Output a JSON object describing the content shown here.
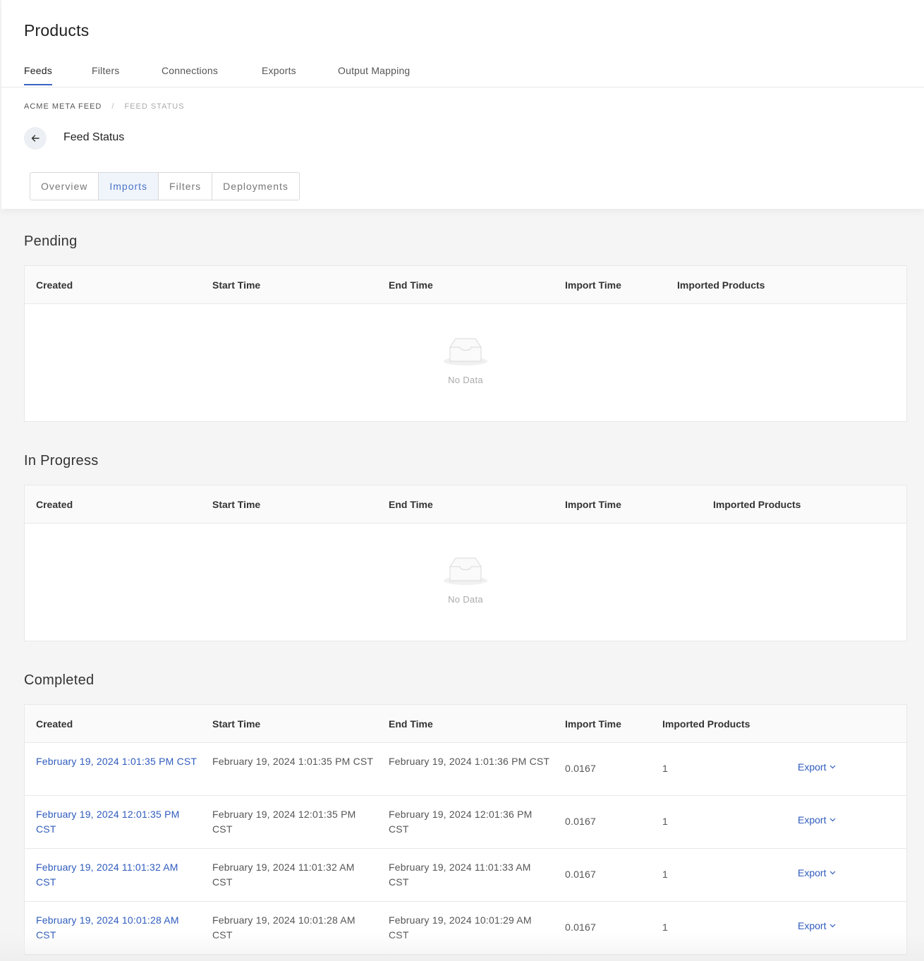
{
  "page": {
    "title": "Products"
  },
  "main_tabs": [
    {
      "label": "Feeds",
      "active": true
    },
    {
      "label": "Filters"
    },
    {
      "label": "Connections"
    },
    {
      "label": "Exports"
    },
    {
      "label": "Output Mapping"
    }
  ],
  "breadcrumb": {
    "parent": "ACME META FEED",
    "separator": "/",
    "current": "FEED STATUS"
  },
  "subheader": {
    "title": "Feed Status"
  },
  "sub_tabs": [
    {
      "label": "Overview"
    },
    {
      "label": "Imports",
      "active": true
    },
    {
      "label": "Filters"
    },
    {
      "label": "Deployments"
    }
  ],
  "columns": [
    "Created",
    "Start Time",
    "End Time",
    "Import Time",
    "Imported Products"
  ],
  "sections": {
    "pending": {
      "title": "Pending",
      "empty_text": "No Data"
    },
    "in_progress": {
      "title": "In Progress",
      "empty_text": "No Data"
    },
    "completed": {
      "title": "Completed",
      "rows": [
        {
          "created": "February 19, 2024 1:01:35 PM CST",
          "start": "February 19, 2024 1:01:35 PM CST",
          "end": "February 19, 2024 1:01:36 PM CST",
          "import_time": "0.0167",
          "imported": "1",
          "action": "Export"
        },
        {
          "created": "February 19, 2024 12:01:35 PM CST",
          "start": "February 19, 2024 12:01:35 PM CST",
          "end": "February 19, 2024 12:01:36 PM CST",
          "import_time": "0.0167",
          "imported": "1",
          "action": "Export"
        },
        {
          "created": "February 19, 2024 11:01:32 AM CST",
          "start": "February 19, 2024 11:01:32 AM CST",
          "end": "February 19, 2024 11:01:33 AM CST",
          "import_time": "0.0167",
          "imported": "1",
          "action": "Export"
        },
        {
          "created": "February 19, 2024 10:01:28 AM CST",
          "start": "February 19, 2024 10:01:28 AM CST",
          "end": "February 19, 2024 10:01:29 AM CST",
          "import_time": "0.0167",
          "imported": "1",
          "action": "Export"
        }
      ]
    }
  },
  "colors": {
    "accent": "#3b63c4",
    "link": "#2f5bbd",
    "active_tab_bg": "#f0f4fb"
  },
  "icons": {
    "back": "arrow-left-icon",
    "empty": "empty-inbox-icon",
    "export": "chevron-down-icon"
  }
}
